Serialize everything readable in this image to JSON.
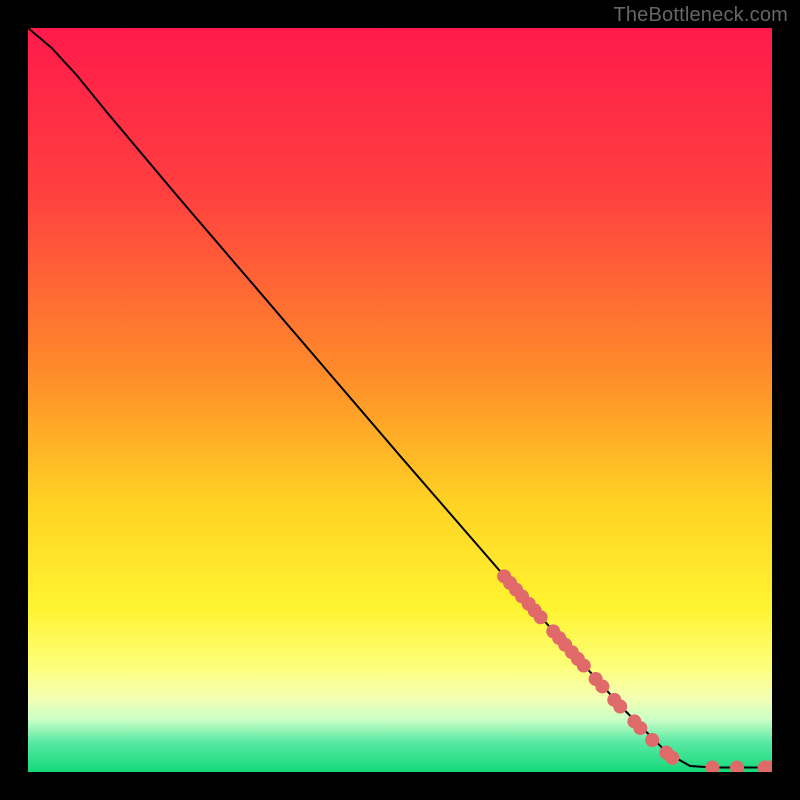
{
  "attribution": "TheBottleneck.com",
  "chart_data": {
    "type": "line",
    "title": "",
    "xlabel": "",
    "ylabel": "",
    "xlim": [
      0,
      100
    ],
    "ylim": [
      0,
      100
    ],
    "gradient_stops": [
      {
        "offset": 0,
        "color": "#ff1a4b"
      },
      {
        "offset": 22,
        "color": "#ff3f3f"
      },
      {
        "offset": 46,
        "color": "#ff8a2b"
      },
      {
        "offset": 64,
        "color": "#ffd323"
      },
      {
        "offset": 78,
        "color": "#fff430"
      },
      {
        "offset": 86,
        "color": "#fdff7c"
      },
      {
        "offset": 90,
        "color": "#f4ffb3"
      },
      {
        "offset": 93,
        "color": "#c9ffc6"
      },
      {
        "offset": 96,
        "color": "#58e9a3"
      },
      {
        "offset": 100,
        "color": "#14d878"
      }
    ],
    "series": [
      {
        "name": "curve",
        "type": "line",
        "color": "#000000",
        "points": [
          {
            "x": 0.0,
            "y": 100.0
          },
          {
            "x": 3.2,
            "y": 97.3
          },
          {
            "x": 6.6,
            "y": 93.6
          },
          {
            "x": 10.5,
            "y": 88.8
          },
          {
            "x": 20.0,
            "y": 77.5
          },
          {
            "x": 35.0,
            "y": 60.0
          },
          {
            "x": 50.0,
            "y": 42.5
          },
          {
            "x": 65.0,
            "y": 25.2
          },
          {
            "x": 80.0,
            "y": 8.5
          },
          {
            "x": 86.0,
            "y": 2.5
          },
          {
            "x": 89.0,
            "y": 0.8
          },
          {
            "x": 92.0,
            "y": 0.6
          },
          {
            "x": 96.0,
            "y": 0.6
          },
          {
            "x": 99.6,
            "y": 0.6
          }
        ]
      },
      {
        "name": "markers",
        "type": "scatter",
        "color": "#e06a6a",
        "radius_px": 7,
        "points": [
          {
            "x": 64.0,
            "y": 26.3
          },
          {
            "x": 64.8,
            "y": 25.4
          },
          {
            "x": 65.6,
            "y": 24.5
          },
          {
            "x": 66.4,
            "y": 23.6
          },
          {
            "x": 67.3,
            "y": 22.6
          },
          {
            "x": 68.1,
            "y": 21.7
          },
          {
            "x": 68.9,
            "y": 20.8
          },
          {
            "x": 70.6,
            "y": 18.9
          },
          {
            "x": 71.4,
            "y": 18.0
          },
          {
            "x": 72.2,
            "y": 17.1
          },
          {
            "x": 73.1,
            "y": 16.1
          },
          {
            "x": 73.9,
            "y": 15.2
          },
          {
            "x": 74.7,
            "y": 14.3
          },
          {
            "x": 76.3,
            "y": 12.5
          },
          {
            "x": 77.2,
            "y": 11.5
          },
          {
            "x": 78.8,
            "y": 9.7
          },
          {
            "x": 79.6,
            "y": 8.8
          },
          {
            "x": 81.5,
            "y": 6.8
          },
          {
            "x": 82.3,
            "y": 5.9
          },
          {
            "x": 83.9,
            "y": 4.3
          },
          {
            "x": 85.8,
            "y": 2.6
          },
          {
            "x": 86.6,
            "y": 1.9
          },
          {
            "x": 92.0,
            "y": 0.6
          },
          {
            "x": 95.3,
            "y": 0.6
          },
          {
            "x": 99.0,
            "y": 0.6
          },
          {
            "x": 99.7,
            "y": 0.6
          }
        ]
      }
    ]
  }
}
